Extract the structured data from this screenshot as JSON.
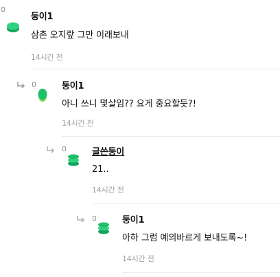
{
  "comments": [
    {
      "author": "둥이1",
      "text": "삼촌 오지랖 그만 이래보내",
      "time": "14시간 전",
      "avatar_color": "#1fbf6a",
      "is_reply": false
    },
    {
      "author": "둥이1",
      "text": "아니 쓰니 몇살임?? 요게 중요할듯?!",
      "time": "14시간 전",
      "avatar_color": "#1fbf6a",
      "is_reply": true
    },
    {
      "author": "글쓴둥이",
      "text": "21..",
      "time": "14시간 전",
      "avatar_color": "#1fbf6a",
      "is_reply": true
    },
    {
      "author": "둥이1",
      "text": "아하 그럼 예의바르게 보내도록~!",
      "time": "14시간 전",
      "avatar_color": "#1fbf6a",
      "is_reply": true
    }
  ],
  "icons": {
    "reply": "reply-arrow-icon",
    "avatar": "avatar-icon",
    "marker": "dot-marker-icon"
  }
}
